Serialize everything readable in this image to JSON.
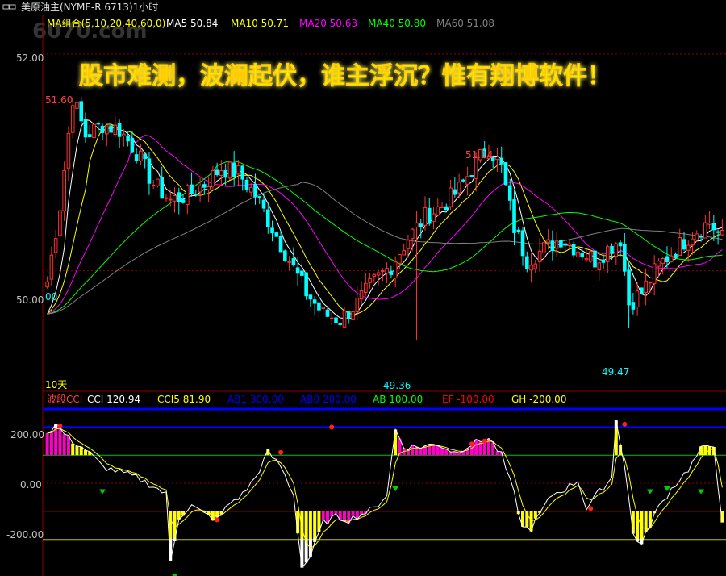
{
  "window": {
    "title": "美原油主(NYME-R 6713)1小时",
    "watermark": "6070.com"
  },
  "banner": "股市难测，波澜起伏，谁主浮沉？惟有翔博软件！",
  "legend": {
    "group_label": "MA组合(5,10,20,40,60,0)",
    "items": [
      {
        "label": "MA5",
        "value": "50.84",
        "color": "#ffffff"
      },
      {
        "label": "MA10",
        "value": "50.71",
        "color": "#ffff00"
      },
      {
        "label": "MA20",
        "value": "50.63",
        "color": "#ff00ff"
      },
      {
        "label": "MA40",
        "value": "50.80",
        "color": "#00ff00"
      },
      {
        "label": "MA60",
        "value": "51.08",
        "color": "#808080"
      }
    ]
  },
  "price_axis": {
    "ticks": [
      "52.00",
      "50.00"
    ]
  },
  "annotations": {
    "high1": "51.60",
    "high2": "51.14",
    "low1": "49.36",
    "low2": "49.47",
    "start": "00",
    "period": "10天"
  },
  "cci_legend": {
    "name": "波段CCI",
    "items": [
      {
        "label": "CCI",
        "value": "120.94",
        "color": "#ffffff"
      },
      {
        "label": "CCI5",
        "value": "81.90",
        "color": "#ffff00"
      },
      {
        "label": "AB1",
        "value": "300.00",
        "color": "#0000ff"
      },
      {
        "label": "AB0",
        "value": "200.00",
        "color": "#0000ff"
      },
      {
        "label": "AB",
        "value": "100.00",
        "color": "#00ff00"
      },
      {
        "label": "EF",
        "value": "-100.00",
        "color": "#ff0000"
      },
      {
        "label": "GH",
        "value": "-200.00",
        "color": "#ffff00"
      }
    ]
  },
  "cci_axis": {
    "ticks": [
      "200.00",
      "0.00",
      "-200.00"
    ]
  },
  "colors": {
    "up": "#ff3232",
    "down": "#00ffff",
    "grid": "#8b0000",
    "banner": "#ffff00"
  },
  "chart_data": [
    {
      "type": "candlestick",
      "title": "美原油主(NYME-R 6713)1小时",
      "ylim": [
        49.0,
        52.2
      ],
      "price_levels": [
        52.0,
        50.0
      ],
      "series_names": [
        "MA5",
        "MA10",
        "MA20",
        "MA40",
        "MA60"
      ],
      "path_points": [
        [
          0,
          49.9
        ],
        [
          3,
          50.6
        ],
        [
          6,
          51.6
        ],
        [
          9,
          51.25
        ],
        [
          13,
          51.35
        ],
        [
          17,
          51.3
        ],
        [
          21,
          51.1
        ],
        [
          25,
          50.8
        ],
        [
          29,
          50.65
        ],
        [
          33,
          50.7
        ],
        [
          37,
          50.8
        ],
        [
          41,
          50.95
        ],
        [
          45,
          50.9
        ],
        [
          49,
          50.7
        ],
        [
          53,
          50.4
        ],
        [
          57,
          50.1
        ],
        [
          61,
          49.8
        ],
        [
          65,
          49.6
        ],
        [
          69,
          49.55
        ],
        [
          73,
          49.7
        ],
        [
          77,
          49.9
        ],
        [
          81,
          50.05
        ],
        [
          85,
          50.3
        ],
        [
          89,
          50.5
        ],
        [
          93,
          50.6
        ],
        [
          97,
          50.75
        ],
        [
          101,
          51.0
        ],
        [
          104,
          51.14
        ],
        [
          107,
          50.95
        ],
        [
          110,
          50.4
        ],
        [
          113,
          50.1
        ],
        [
          117,
          50.2
        ],
        [
          121,
          50.3
        ],
        [
          125,
          50.2
        ],
        [
          129,
          50.1
        ],
        [
          132,
          50.2
        ],
        [
          135,
          50.3
        ],
        [
          137,
          49.7
        ],
        [
          140,
          49.8
        ],
        [
          144,
          50.05
        ],
        [
          148,
          50.2
        ],
        [
          152,
          50.35
        ],
        [
          156,
          50.45
        ],
        [
          159,
          50.3
        ]
      ],
      "low_spike_index": 87,
      "low_spike_value": 49.36,
      "low_spike2_index": 137,
      "low_spike2_value": 49.47,
      "high_label_index": 6,
      "high2_index": 104
    },
    {
      "type": "line",
      "title": "波段CCI",
      "ylim": [
        -330,
        270
      ],
      "levels": [
        300,
        200,
        100,
        0,
        -100,
        -200
      ],
      "cci_points": [
        [
          0,
          180
        ],
        [
          2,
          210
        ],
        [
          5,
          160
        ],
        [
          9,
          120
        ],
        [
          13,
          60
        ],
        [
          17,
          40
        ],
        [
          21,
          20
        ],
        [
          25,
          -10
        ],
        [
          28,
          -40
        ],
        [
          29,
          -280
        ],
        [
          31,
          -120
        ],
        [
          34,
          -80
        ],
        [
          37,
          -110
        ],
        [
          40,
          -130
        ],
        [
          43,
          -70
        ],
        [
          46,
          -40
        ],
        [
          49,
          20
        ],
        [
          52,
          110
        ],
        [
          55,
          60
        ],
        [
          58,
          -40
        ],
        [
          60,
          -300
        ],
        [
          62,
          -260
        ],
        [
          65,
          -140
        ],
        [
          68,
          -120
        ],
        [
          71,
          -130
        ],
        [
          74,
          -110
        ],
        [
          77,
          -90
        ],
        [
          80,
          -40
        ],
        [
          82,
          190
        ],
        [
          84,
          130
        ],
        [
          88,
          130
        ],
        [
          92,
          140
        ],
        [
          96,
          110
        ],
        [
          100,
          140
        ],
        [
          104,
          160
        ],
        [
          107,
          100
        ],
        [
          110,
          -40
        ],
        [
          112,
          -160
        ],
        [
          114,
          -160
        ],
        [
          116,
          -110
        ],
        [
          119,
          -40
        ],
        [
          122,
          -20
        ],
        [
          125,
          10
        ],
        [
          127,
          -90
        ],
        [
          130,
          -30
        ],
        [
          133,
          20
        ],
        [
          134,
          230
        ],
        [
          136,
          60
        ],
        [
          138,
          -180
        ],
        [
          140,
          -220
        ],
        [
          143,
          -110
        ],
        [
          147,
          -20
        ],
        [
          151,
          50
        ],
        [
          154,
          120
        ],
        [
          157,
          140
        ],
        [
          159,
          -150
        ]
      ],
      "signal_dots_up": [
        [
          3,
          205
        ],
        [
          40,
          -130
        ],
        [
          55,
          110
        ],
        [
          67,
          200
        ],
        [
          100,
          140
        ],
        [
          103,
          150
        ],
        [
          128,
          -90
        ]
      ],
      "signal_dots_down": [
        [
          13,
          -30
        ],
        [
          30,
          -330
        ],
        [
          82,
          -20
        ],
        [
          136,
          210
        ],
        [
          142,
          -30
        ],
        [
          146,
          -20
        ],
        [
          154,
          -30
        ]
      ]
    }
  ]
}
